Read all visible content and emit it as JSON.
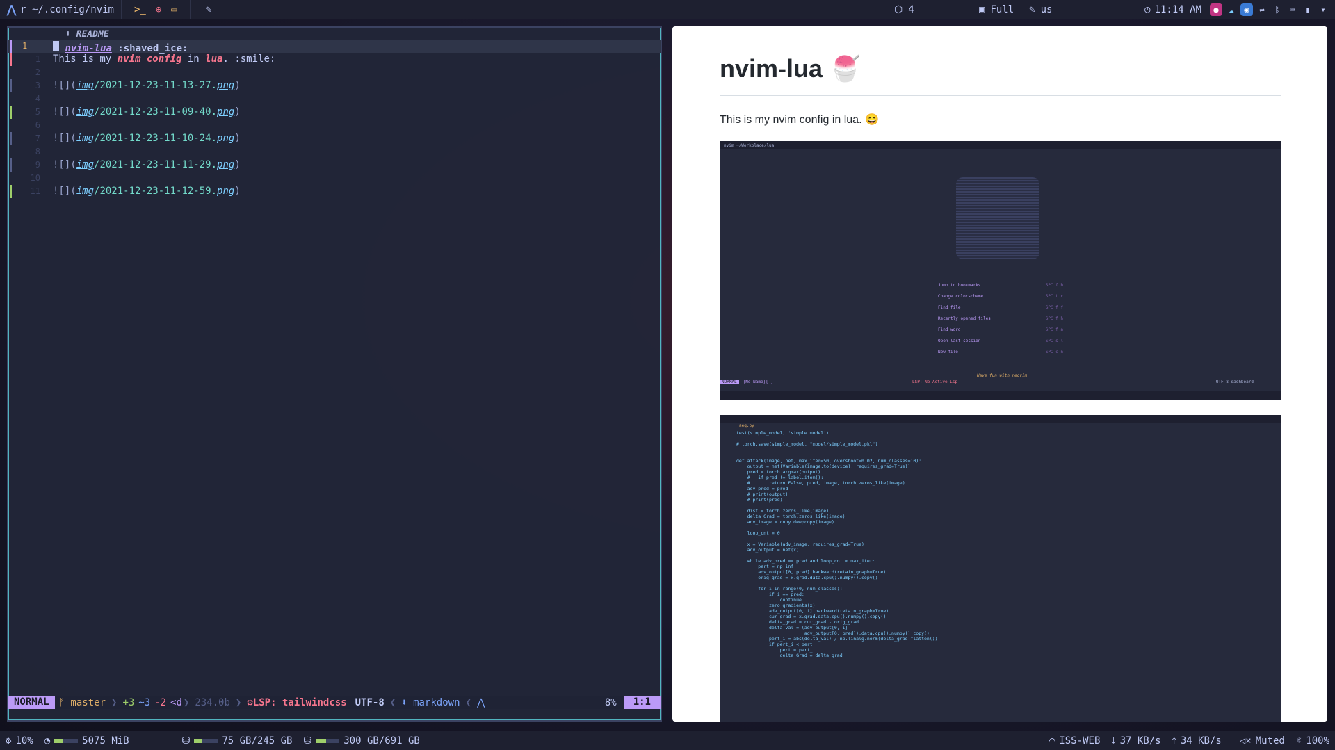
{
  "topbar": {
    "path": "r ~/.config/nvim",
    "workspaces_count": "4",
    "layout": "Full",
    "keyboard": "us",
    "clock": "11:14 AM",
    "icons": [
      "arch-logo-icon",
      "terminal-icon",
      "web-icon",
      "folder-icon",
      "feather-icon"
    ]
  },
  "nvim": {
    "winbar": "README",
    "lines": [
      {
        "num": "1",
        "current": true,
        "parts": [
          {
            "t": "nvim-lua",
            "c": "h1link"
          },
          {
            "t": " :shaved_ice:",
            "c": "h1"
          }
        ]
      },
      {
        "num": "1",
        "parts": [
          {
            "t": "This is my ",
            "c": "t-plain"
          },
          {
            "t": "nvim",
            "c": "t-red"
          },
          {
            "t": " ",
            "c": "t-plain"
          },
          {
            "t": "config",
            "c": "t-red"
          },
          {
            "t": " in ",
            "c": "t-plain"
          },
          {
            "t": "lua",
            "c": "t-red"
          },
          {
            "t": ". :smile:",
            "c": "t-plain"
          }
        ]
      },
      {
        "num": "2",
        "parts": []
      },
      {
        "num": "3",
        "parts": [
          {
            "t": "![](",
            "c": "t-brk"
          },
          {
            "t": "img",
            "c": "t-teal"
          },
          {
            "t": "/2021-12-23-11-13-27.",
            "c": "t-teal2"
          },
          {
            "t": "png",
            "c": "t-teal"
          },
          {
            "t": ")",
            "c": "t-brk"
          }
        ]
      },
      {
        "num": "4",
        "parts": []
      },
      {
        "num": "5",
        "parts": [
          {
            "t": "![](",
            "c": "t-brk"
          },
          {
            "t": "img",
            "c": "t-teal"
          },
          {
            "t": "/2021-12-23-11-09-40.",
            "c": "t-teal2"
          },
          {
            "t": "png",
            "c": "t-teal"
          },
          {
            "t": ")",
            "c": "t-brk"
          }
        ]
      },
      {
        "num": "6",
        "parts": []
      },
      {
        "num": "7",
        "parts": [
          {
            "t": "![](",
            "c": "t-brk"
          },
          {
            "t": "img",
            "c": "t-teal"
          },
          {
            "t": "/2021-12-23-11-10-24.",
            "c": "t-teal2"
          },
          {
            "t": "png",
            "c": "t-teal"
          },
          {
            "t": ")",
            "c": "t-brk"
          }
        ]
      },
      {
        "num": "8",
        "parts": []
      },
      {
        "num": "9",
        "parts": [
          {
            "t": "![](",
            "c": "t-brk"
          },
          {
            "t": "img",
            "c": "t-teal"
          },
          {
            "t": "/2021-12-23-11-11-29.",
            "c": "t-teal2"
          },
          {
            "t": "png",
            "c": "t-teal"
          },
          {
            "t": ")",
            "c": "t-brk"
          }
        ]
      },
      {
        "num": "10",
        "parts": []
      },
      {
        "num": "11",
        "parts": [
          {
            "t": "![](",
            "c": "t-brk"
          },
          {
            "t": "img",
            "c": "t-teal"
          },
          {
            "t": "/2021-12-23-11-12-59.",
            "c": "t-teal2"
          },
          {
            "t": "png",
            "c": "t-teal"
          },
          {
            "t": ")",
            "c": "t-brk"
          }
        ]
      }
    ],
    "status": {
      "mode": "NORMAL",
      "branch": "master",
      "added": "+3",
      "changed": "~3",
      "removed": "-2",
      "cd": "<d",
      "size": "234.0b",
      "lsp": "LSP: tailwindcss",
      "encoding": "UTF-8",
      "filetype": "markdown",
      "percent": "8%",
      "position": "1:1"
    }
  },
  "preview": {
    "title": "nvim-lua",
    "emoji": "🍧",
    "paragraph": "This is my nvim config in lua. 😄",
    "shot1": {
      "topbar": "nvim ~/Workplace/lua",
      "menu": [
        {
          "label": "Jump to bookmarks",
          "key": "SPC f b"
        },
        {
          "label": "Change colorscheme",
          "key": "SPC t c"
        },
        {
          "label": "Find file",
          "key": "SPC f f"
        },
        {
          "label": "Recently opened files",
          "key": "SPC f h"
        },
        {
          "label": "Find word",
          "key": "SPC f a"
        },
        {
          "label": "Open last session",
          "key": "SPC s l"
        },
        {
          "label": "New file",
          "key": "SPC c n"
        }
      ],
      "footer": "Have fun with neovim",
      "status_mode": "NORMAL",
      "status_name": "[No Name][-]",
      "status_lsp": "LSP: No Active Lsp",
      "status_right": "UTF-8  dashboard"
    },
    "shot2": {
      "file": "aeq.py",
      "code": [
        "test(simple_model, 'simple model')",
        "",
        "# torch.save(simple_model, \"model/simple_model.pkl\")",
        "",
        "",
        "def attack(image, net, max_iter=50, overshoot=0.02, num_classes=10):",
        "    output = net(Variable(image.to(device), requires_grad=True))",
        "    pred = torch.argmax(output)",
        "    #   if pred != label.item():",
        "    #       return False, pred, image, torch.zeros_like(image)",
        "    adv_pred = pred",
        "    # print(output)",
        "    # print(pred)",
        "",
        "    dist = torch.zeros_like(image)",
        "    delta_Grad = torch.zeros_like(image)",
        "    adv_image = copy.deepcopy(image)",
        "",
        "    loop_cnt = 0",
        "",
        "    x = Variable(adv_image, requires_grad=True)",
        "    adv_output = net(x)",
        "",
        "    while adv_pred == pred and loop_cnt < max_iter:",
        "        pert = np.inf",
        "        adv_output[0, pred].backward(retain_graph=True)",
        "        orig_grad = x.grad.data.cpu().numpy().copy()",
        "",
        "        for i in range(0, num_classes):",
        "            if i == pred:",
        "                continue",
        "            zero_gradients(x)",
        "            adv_output[0, i].backward(retain_graph=True)",
        "            cur_grad = x.grad.data.cpu().numpy().copy()",
        "            delta_grad = cur_grad - orig_grad",
        "            delta_val = (adv_output[0, i] -",
        "                         adv_output[0, pred]).data.cpu().numpy().copy()",
        "            pert_i = abs(delta_val) / np.linalg.norm(delta_grad.flatten())",
        "            if pert_i < pert:",
        "                pert = pert_i",
        "                delta_Grad = delta_grad"
      ]
    }
  },
  "bottombar": {
    "cpu": "10%",
    "mem": "5075 MiB",
    "disk1": "75 GB/245 GB",
    "disk2": "300 GB/691 GB",
    "wifi": "ISS-WEB",
    "down": "37 KB/s",
    "up": "34 KB/s",
    "volume": "Muted",
    "brightness": "100%",
    "cpu_level": 0.1,
    "mem_level": 0.35,
    "disk1_level": 0.31,
    "disk2_level": 0.43
  },
  "colors": {
    "accent": "#bb9af7",
    "bar": "#1e2030",
    "editor_bg": "#222638"
  }
}
